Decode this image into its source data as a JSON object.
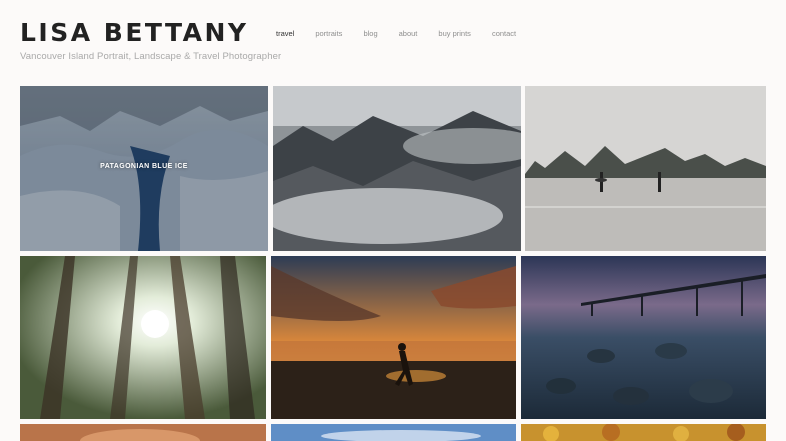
{
  "site": {
    "title": "LISA BETTANY",
    "tagline": "Vancouver Island Portrait, Landscape & Travel Photographer"
  },
  "nav": {
    "items": [
      {
        "label": "travel",
        "active": true
      },
      {
        "label": "portraits"
      },
      {
        "label": "blog"
      },
      {
        "label": "about"
      },
      {
        "label": "buy prints"
      },
      {
        "label": "contact"
      }
    ]
  },
  "gallery": {
    "tiles": [
      {
        "title": "PATAGONIAN BLUE ICE"
      }
    ]
  }
}
